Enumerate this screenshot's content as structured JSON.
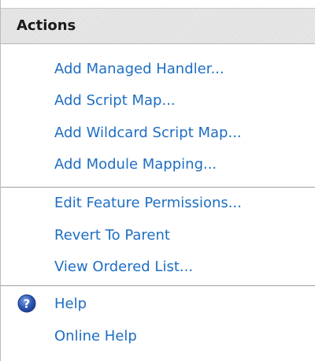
{
  "panel": {
    "title": "Actions"
  },
  "groups": [
    {
      "items": [
        {
          "label": "Add Managed Handler..."
        },
        {
          "label": "Add Script Map..."
        },
        {
          "label": "Add Wildcard Script Map..."
        },
        {
          "label": "Add Module Mapping..."
        }
      ]
    },
    {
      "items": [
        {
          "label": "Edit Feature Permissions..."
        },
        {
          "label": "Revert To Parent"
        },
        {
          "label": "View Ordered List..."
        }
      ]
    },
    {
      "items": [
        {
          "label": "Help",
          "icon": "help-icon"
        },
        {
          "label": "Online Help"
        }
      ]
    }
  ],
  "colors": {
    "link": "#1e6ec3",
    "header_text": "#1a1a1a",
    "help_icon": "#2d55b3"
  }
}
